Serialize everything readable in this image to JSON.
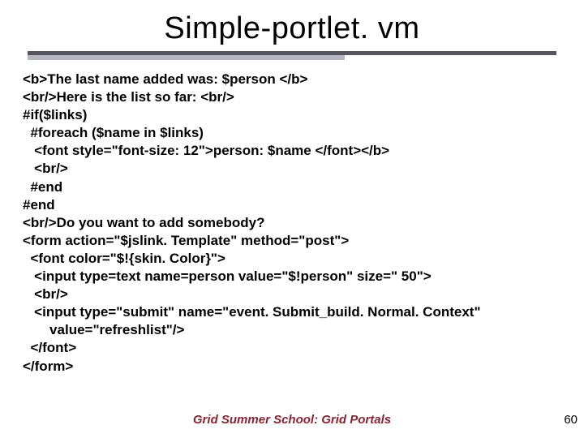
{
  "title": "Simple-portlet. vm",
  "code_lines": [
    "<b>The last name added was: $person </b>",
    "<br/>Here is the list so far: <br/>",
    "#if($links)",
    "  #foreach ($name in $links)",
    "   <font style=\"font-size: 12\">person: $name </font></b>",
    "   <br/>",
    "  #end",
    "#end",
    "<br/>Do you want to add somebody?",
    "<form action=\"$jslink. Template\" method=\"post\">",
    "  <font color=\"$!{skin. Color}\">",
    "   <input type=text name=person value=\"$!person\" size=\" 50\">",
    "   <br/>",
    "   <input type=\"submit\" name=\"event. Submit_build. Normal. Context\"",
    "       value=\"refreshlist\"/>",
    "  </font>",
    "</form>"
  ],
  "footer": "Grid Summer School: Grid Portals",
  "page_number": "60"
}
